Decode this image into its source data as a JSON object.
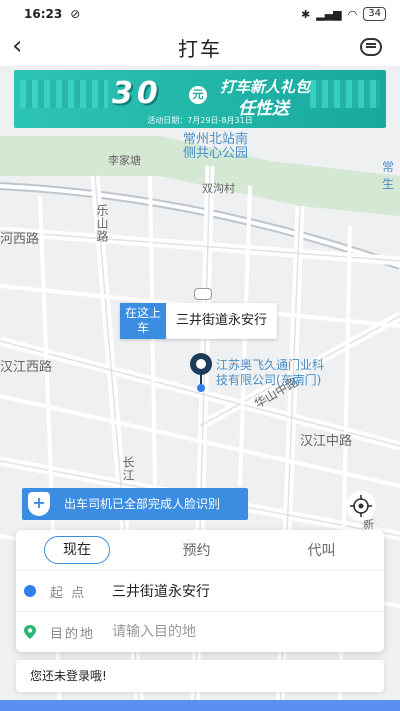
{
  "status_bar": {
    "time": "16:23",
    "battery": "34"
  },
  "header": {
    "title": "打车"
  },
  "banner": {
    "amount": "30",
    "unit": "元",
    "promo_line1": "打车新人礼包",
    "promo_line2": "任性送",
    "date": "活动日期：7月29日-8月31日"
  },
  "map": {
    "labels": {
      "north_station": "常州北站南",
      "park": "侧共心公园",
      "li_jia_tang": "李家塘",
      "shuang_gou_cun": "双沟村",
      "le_shan_lu": "乐山路",
      "he_xi_lu": "河西路",
      "han_jiang_xi_lu": "汉江西路",
      "han_jiang_zhong_lu": "汉江中路",
      "hua_shan_zhong_lu": "华山中路",
      "chang_jiang": "长江",
      "company_poi": "江苏奥飞久通门业科技有限公司(东南门)",
      "edge_right": "常生",
      "new": "新"
    }
  },
  "pickup_tag": {
    "here": "在这上车",
    "address": "三井街道永安行"
  },
  "face_notice": {
    "text": "出车司机已全部完成人脸识别"
  },
  "panel": {
    "tabs": [
      "现在",
      "预约",
      "代叫"
    ],
    "origin_label": "起 点",
    "origin_value": "三井街道永安行",
    "dest_label": "目的地",
    "dest_placeholder": "请输入目的地"
  },
  "login": {
    "text": "您还未登录哦!"
  },
  "colors": {
    "accent": "#3a8de0",
    "banner": "#1fb5a8"
  }
}
